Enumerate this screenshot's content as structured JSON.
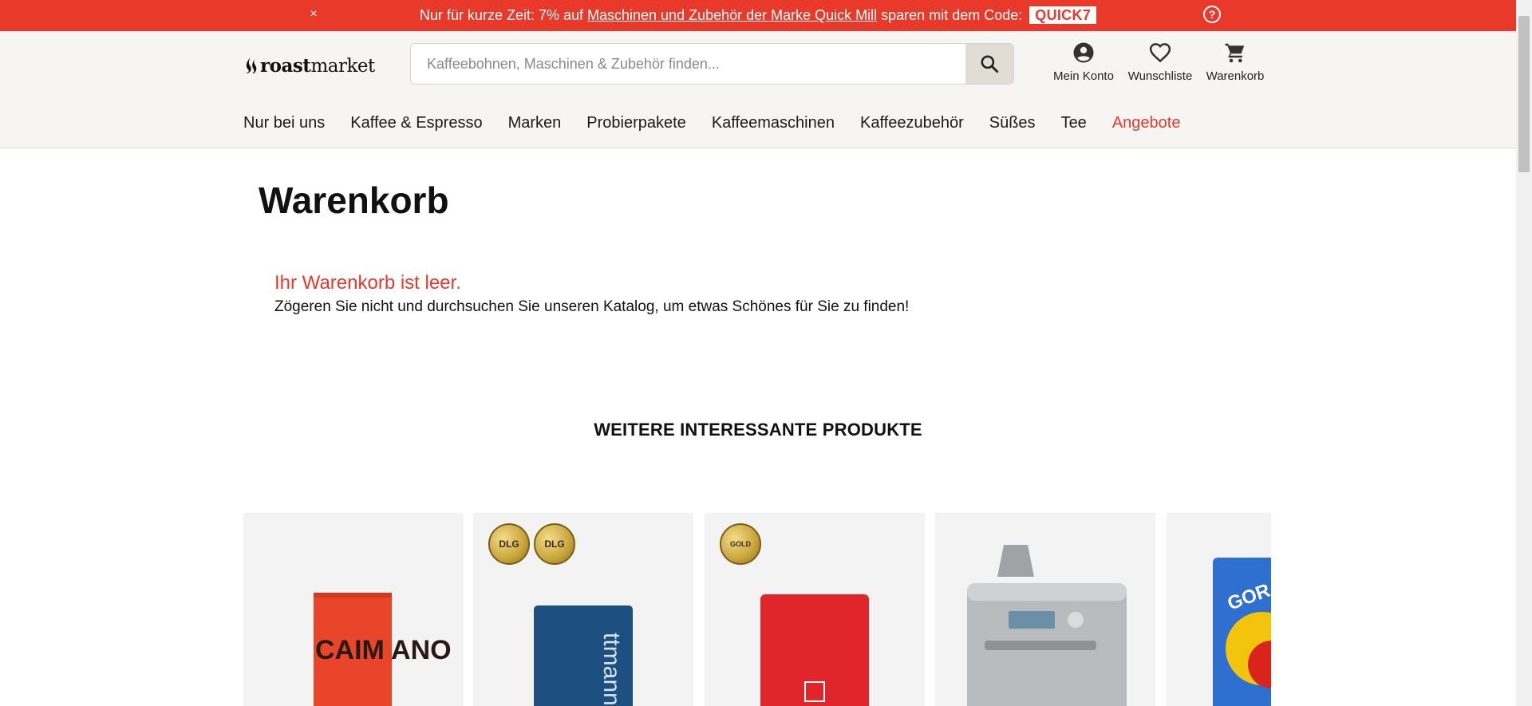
{
  "promo": {
    "close": "×",
    "text_before": "Nur für kurze Zeit: 7% auf ",
    "link": "Maschinen und Zubehör der Marke Quick Mill",
    "text_after": " sparen mit dem Code:",
    "code": "QUICK7",
    "help": "?",
    "background": "#e8392b"
  },
  "header": {
    "logo_bold": "roast",
    "logo_light": "market",
    "search_placeholder": "Kaffeebohnen, Maschinen & Zubehör finden...",
    "account_label": "Mein Konto",
    "wishlist_label": "Wunschliste",
    "cart_label": "Warenkorb"
  },
  "nav": {
    "items": [
      "Nur bei uns",
      "Kaffee & Espresso",
      "Marken",
      "Probierpakete",
      "Kaffeemaschinen",
      "Kaffeezubehör",
      "Süßes",
      "Tee",
      "Angebote"
    ],
    "accent": "#e8392b"
  },
  "main": {
    "title": "Warenkorb",
    "empty_title": "Ihr Warenkorb ist leer.",
    "empty_text_1": "Zögeren Sie nicht und ",
    "empty_link": "durchsuchen Sie unseren Katalog",
    "empty_text_2": ", um etwas Schönes für Sie zu finden!"
  },
  "recommendations": {
    "title": "WEITERE INTERESSANTE PRODUKTE",
    "products": [
      {
        "pack_text": "CAIM ANO",
        "pack_color": "#e8452a",
        "badges": []
      },
      {
        "pack_text": "ttmann",
        "pack_color": "#1d4f80",
        "badges": [
          "DLG",
          "DLG"
        ]
      },
      {
        "pack_text": "",
        "pack_color": "#e0262a",
        "badges": [
          "GOLD"
        ]
      },
      {
        "pack_text": "",
        "pack_color": "#b9bcbf",
        "badges": []
      },
      {
        "pack_text": "GOR",
        "pack_color": "#2f6fd0",
        "badges": []
      }
    ]
  }
}
